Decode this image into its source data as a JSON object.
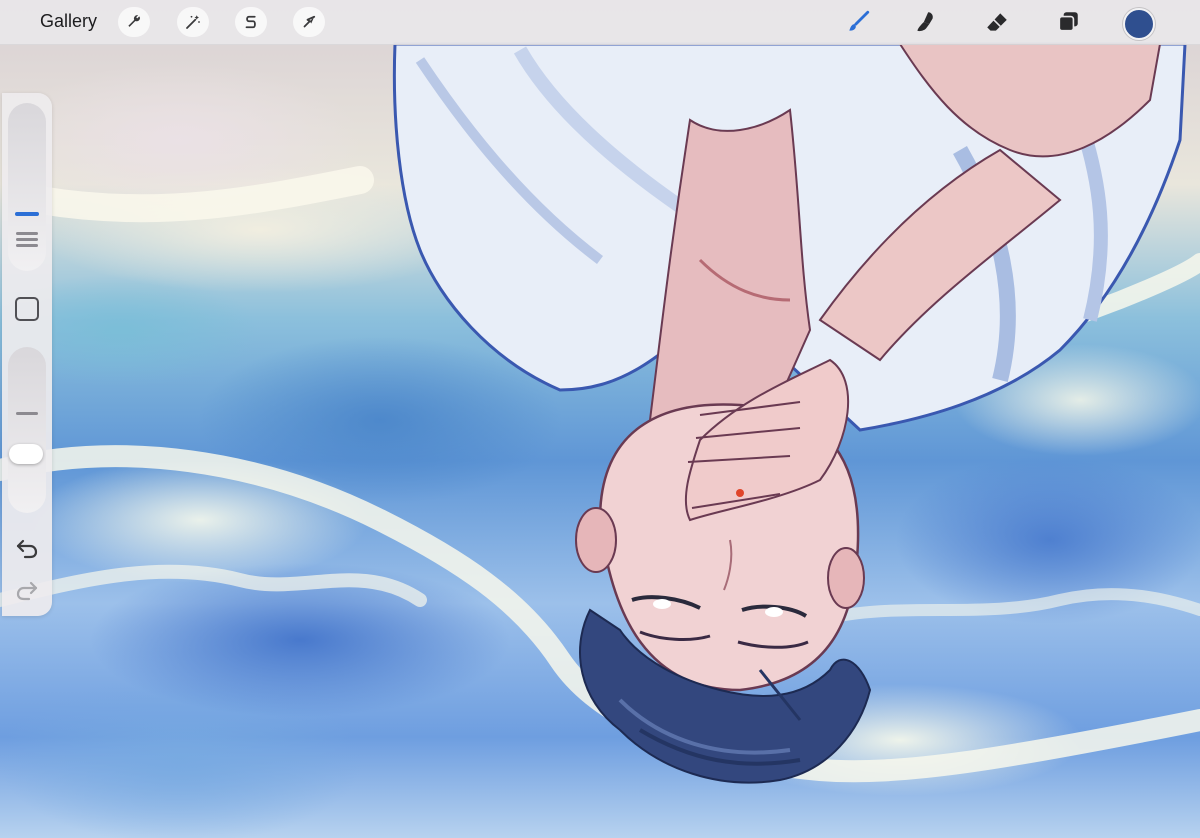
{
  "topbar": {
    "gallery_label": "Gallery",
    "left_tools": [
      {
        "name": "actions",
        "icon": "wrench-icon"
      },
      {
        "name": "adjustments",
        "icon": "magic-wand-icon"
      },
      {
        "name": "selection",
        "icon": "selection-s-icon"
      },
      {
        "name": "transform",
        "icon": "arrow-cursor-icon"
      }
    ],
    "right_tools": [
      {
        "name": "brush",
        "icon": "brush-icon",
        "active": true
      },
      {
        "name": "smudge",
        "icon": "smudge-icon",
        "active": false
      },
      {
        "name": "eraser",
        "icon": "eraser-icon",
        "active": false
      },
      {
        "name": "layers",
        "icon": "layers-icon",
        "active": false
      }
    ],
    "current_color": "#2f4f8f"
  },
  "sidebar": {
    "brush_size_icon": "size-slider",
    "modify_icon": "square-icon",
    "opacity_icon": "opacity-slider",
    "undo_icon": "undo-icon",
    "redo_icon": "redo-icon"
  },
  "colors": {
    "accent": "#2c6fd6",
    "toolbar_bg": "#e8e6e8"
  }
}
